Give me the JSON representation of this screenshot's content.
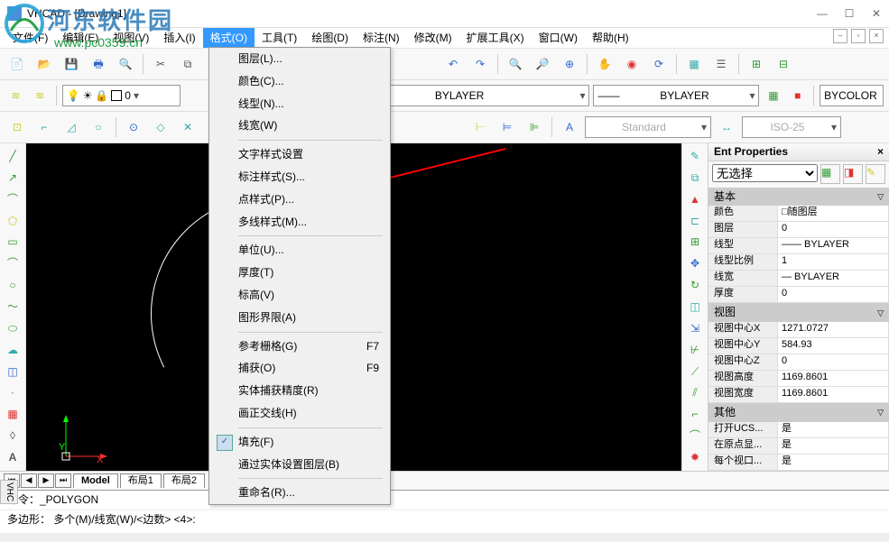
{
  "title": "VHCAD - [Drawing1]",
  "menu": {
    "file": "文件(F)",
    "edit": "编辑(E)",
    "view": "视图(V)",
    "insert": "插入(I)",
    "format": "格式(O)",
    "tools": "工具(T)",
    "draw": "绘图(D)",
    "dim": "标注(N)",
    "modify": "修改(M)",
    "ext": "扩展工具(X)",
    "window": "窗口(W)",
    "help": "帮助(H)"
  },
  "dropdown": [
    {
      "label": "图层(L)..."
    },
    {
      "label": "颜色(C)..."
    },
    {
      "label": "线型(N)..."
    },
    {
      "label": "线宽(W)"
    },
    {
      "sep": true
    },
    {
      "label": "文字样式设置"
    },
    {
      "label": "标注样式(S)..."
    },
    {
      "label": "点样式(P)..."
    },
    {
      "label": "多线样式(M)..."
    },
    {
      "sep": true
    },
    {
      "label": "单位(U)..."
    },
    {
      "label": "厚度(T)"
    },
    {
      "label": "标高(V)"
    },
    {
      "label": "图形界限(A)"
    },
    {
      "sep": true
    },
    {
      "label": "参考栅格(G)",
      "short": "F7"
    },
    {
      "label": "捕获(O)",
      "short": "F9"
    },
    {
      "label": "实体捕获精度(R)"
    },
    {
      "label": "画正交线(H)"
    },
    {
      "sep": true
    },
    {
      "label": "填充(F)",
      "checked": true
    },
    {
      "label": "通过实体设置图层(B)"
    },
    {
      "sep": true
    },
    {
      "label": "重命名(R)..."
    }
  ],
  "layer": {
    "name": "0",
    "line1": "BYLAYER",
    "line2": "BYLAYER",
    "bycolor": "BYCOLOR",
    "standard": "Standard",
    "iso": "ISO-25"
  },
  "props": {
    "title": "Ent Properties",
    "noSel": "无选择",
    "groups": {
      "basic": {
        "title": "基本",
        "rows": [
          {
            "k": "颜色",
            "v": "□随图层"
          },
          {
            "k": "图层",
            "v": "0"
          },
          {
            "k": "线型",
            "v": "—— BYLAYER"
          },
          {
            "k": "线型比例",
            "v": "1"
          },
          {
            "k": "线宽",
            "v": "— BYLAYER"
          },
          {
            "k": "厚度",
            "v": "0"
          }
        ]
      },
      "view": {
        "title": "视图",
        "rows": [
          {
            "k": "视图中心X",
            "v": "1271.0727"
          },
          {
            "k": "视图中心Y",
            "v": "584.93"
          },
          {
            "k": "视图中心Z",
            "v": "0"
          },
          {
            "k": "视图高度",
            "v": "1169.8601"
          },
          {
            "k": "视图宽度",
            "v": "1169.8601"
          }
        ]
      },
      "other": {
        "title": "其他",
        "rows": [
          {
            "k": "打开UCS...",
            "v": "是"
          },
          {
            "k": "在原点显...",
            "v": "是"
          },
          {
            "k": "每个视口...",
            "v": "是"
          }
        ]
      }
    }
  },
  "tabs": {
    "model": "Model",
    "l1": "布局1",
    "l2": "布局2"
  },
  "cmd": {
    "l1": "命令：_POLYGON",
    "l2": "多边形：  多个(M)/线宽(W)/<边数> <4>:"
  },
  "watermark": {
    "main": "河东软件园",
    "url": "www.pc0359.cn"
  },
  "axis": {
    "y": "Y",
    "x": "X"
  }
}
